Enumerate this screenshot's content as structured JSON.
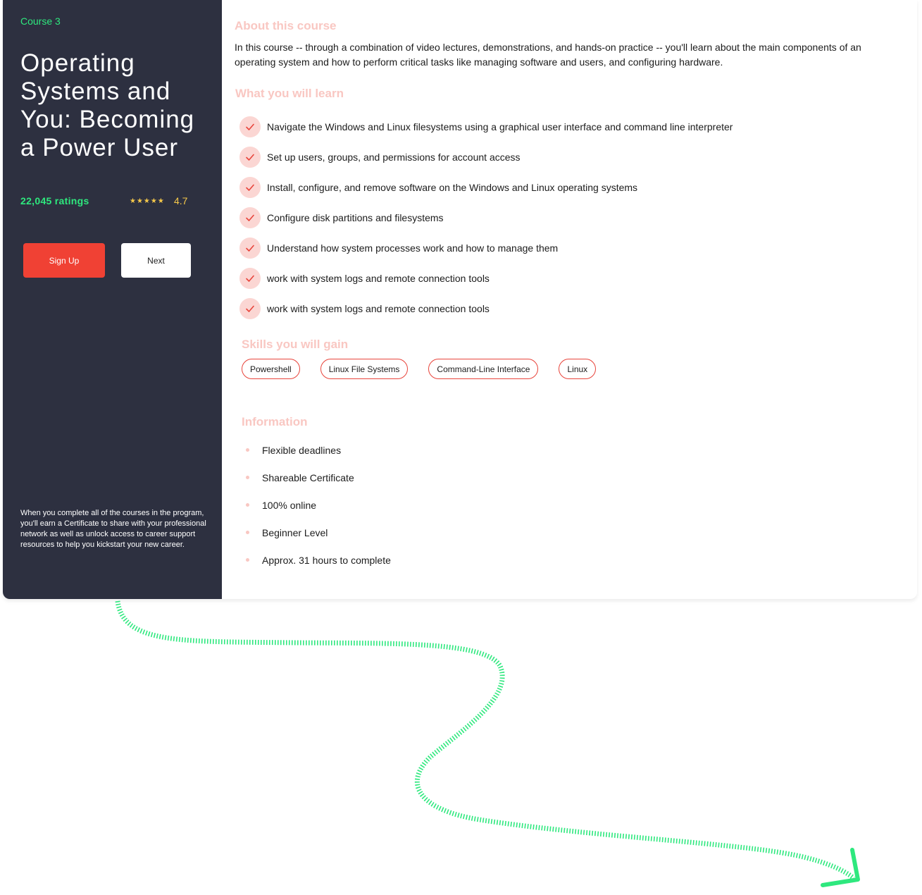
{
  "sidebar": {
    "course_tag": "Course 3",
    "title": "Operating Systems and You: Becoming a Power User",
    "ratings_count": "22,045 ratings",
    "stars": "★★★★★",
    "rating_value": "4.7",
    "signup_label": "Sign Up",
    "next_label": "Next",
    "footnote": "When you complete all of the courses in the program, you'll earn a Certificate to share with your professional network as well as unlock access to career support resources to help you kickstart your new career."
  },
  "about": {
    "heading": "About this course",
    "text": "In this course -- through a combination of video lectures, demonstrations, and hands-on practice -- you'll learn about the main components of an operating system and how to perform critical tasks like managing software and users, and configuring hardware."
  },
  "learn": {
    "heading": "What you will learn",
    "items": [
      "Navigate the Windows and Linux filesystems using a graphical user interface and command line interpreter",
      "Set up users, groups, and permissions for account access",
      "Install, configure, and remove software on the Windows and Linux operating systems",
      "Configure disk partitions and filesystems",
      "Understand how system processes work and how to manage them",
      "work with system logs and remote connection tools",
      "work with system logs and remote connection tools"
    ]
  },
  "skills": {
    "heading": "Skills you will gain",
    "items": [
      "Powershell",
      "Linux File Systems",
      "Command-Line Interface",
      "Linux"
    ]
  },
  "information": {
    "heading": "Information",
    "items": [
      "Flexible deadlines",
      "Shareable Certificate",
      "100% online",
      "Beginner Level",
      "Approx. 31 hours to complete"
    ]
  },
  "colors": {
    "sidebar_bg": "#2d3040",
    "accent_green": "#2ee87e",
    "accent_red": "#f04134",
    "heading_pink": "#f9c7c2",
    "star_gold": "#f6c94a"
  },
  "icons": {
    "check": "check-icon",
    "arrow": "arrow-head-icon"
  }
}
